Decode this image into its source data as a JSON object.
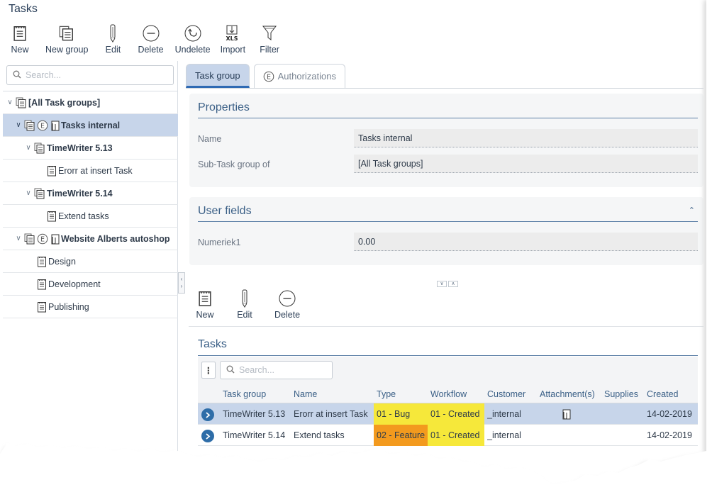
{
  "window": {
    "title": "Tasks"
  },
  "toolbar": {
    "new": "New",
    "new_group": "New group",
    "edit": "Edit",
    "delete": "Delete",
    "undelete": "Undelete",
    "import": "Import",
    "filter": "Filter",
    "xls_badge": "XLS"
  },
  "left": {
    "search_placeholder": "Search...",
    "tree": [
      {
        "label": "[All Task groups]"
      },
      {
        "label": "Tasks internal"
      },
      {
        "label": "TimeWriter 5.13"
      },
      {
        "label": "Erorr at insert Task"
      },
      {
        "label": "TimeWriter 5.14"
      },
      {
        "label": "Extend tasks"
      },
      {
        "label": "Website Alberts autoshop"
      },
      {
        "label": "Design"
      },
      {
        "label": "Development"
      },
      {
        "label": "Publishing"
      }
    ]
  },
  "tabs": [
    {
      "label": "Task group"
    },
    {
      "label": "Authorizations"
    }
  ],
  "properties": {
    "title": "Properties",
    "name_label": "Name",
    "name_value": "Tasks internal",
    "sub_label": "Sub-Task group of",
    "sub_value": "[All Task groups]"
  },
  "user_fields": {
    "title": "User fields",
    "num_label": "Numeriek1",
    "num_value": "0.00"
  },
  "toolbar2": {
    "new": "New",
    "edit": "Edit",
    "delete": "Delete"
  },
  "tasks": {
    "title": "Tasks",
    "search_placeholder": "Search...",
    "columns": [
      "Task group",
      "Name",
      "Type",
      "Workflow",
      "Customer",
      "Attachment(s)",
      "Supplies",
      "Created"
    ],
    "rows": [
      {
        "task_group": "TimeWriter 5.13",
        "name": "Erorr at insert Task",
        "type": "01 - Bug",
        "workflow": "01 - Created",
        "customer": "_internal",
        "created": "14-02-2019"
      },
      {
        "task_group": "TimeWriter 5.14",
        "name": "Extend tasks",
        "type": "02 - Feature",
        "workflow": "01 - Created",
        "customer": "_internal",
        "created": "14-02-2019"
      }
    ]
  },
  "colors": {
    "accent": "#2f6ab3",
    "selected": "#c7d5ea",
    "type_bug": "#f6e83a",
    "type_feature": "#f39a1e",
    "workflow": "#f6e83a"
  }
}
